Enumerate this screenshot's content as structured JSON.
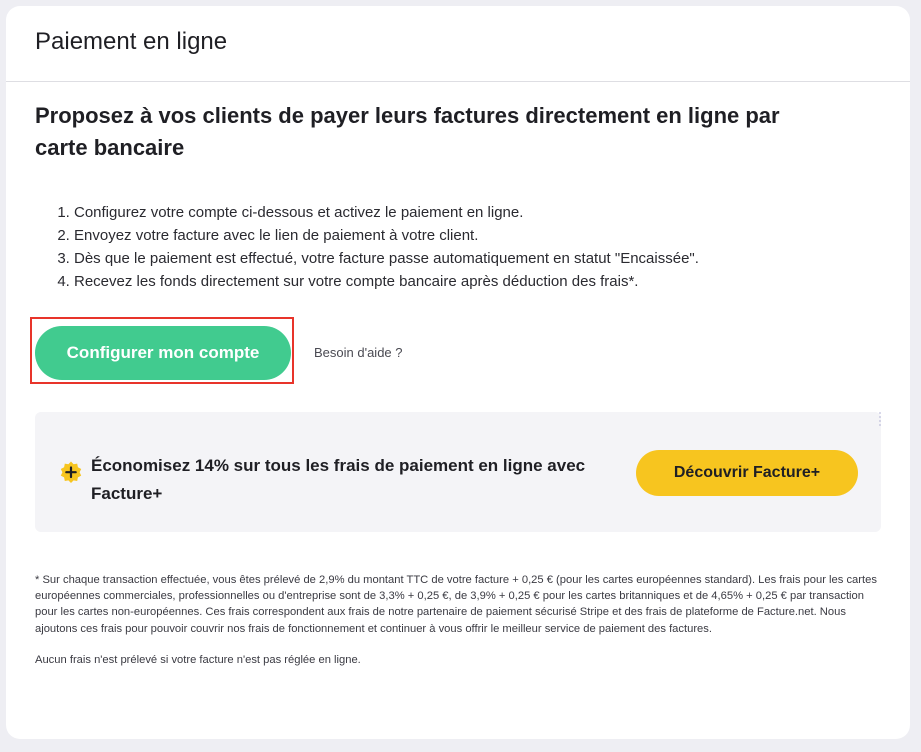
{
  "header": {
    "title": "Paiement en ligne"
  },
  "main": {
    "headline": "Proposez à vos clients de payer leurs factures directement en ligne par carte bancaire",
    "steps": [
      "Configurez votre compte ci-dessous et activez le paiement en ligne.",
      "Envoyez votre facture avec le lien de paiement à votre client.",
      "Dès que le paiement est effectué, votre facture passe automatiquement en statut \"Encaissée\".",
      "Recevez les fonds directement sur votre compte bancaire après déduction des frais*."
    ],
    "cta_label": "Configurer mon compte",
    "help_label": "Besoin d'aide ?"
  },
  "promo": {
    "icon": "plus-badge-icon",
    "text": "Économisez 14% sur tous les frais de paiement en ligne avec Facture+",
    "button_label": "Découvrir Facture+"
  },
  "footer": {
    "note": "* Sur chaque transaction effectuée, vous êtes prélevé de 2,9% du montant TTC de votre facture + 0,25 € (pour les cartes européennes standard). Les frais pour les cartes européennes commerciales, professionnelles ou d'entreprise sont de 3,3% + 0,25 €, de 3,9% + 0,25 € pour les cartes britanniques et de 4,65% + 0,25 € par transaction pour les cartes non-européennes. Ces frais correspondent aux frais de notre partenaire de paiement sécurisé Stripe et des frais de plateforme de Facture.net. Nous ajoutons ces frais pour pouvoir couvrir nos frais de fonctionnement et continuer à vous offrir le meilleur service de paiement des factures.",
    "note_2": "Aucun frais n'est prélevé si votre facture n'est pas réglée en ligne."
  },
  "colors": {
    "primary": "#41cb8f",
    "accent": "#f7c51f",
    "highlight_border": "#e8342a"
  }
}
